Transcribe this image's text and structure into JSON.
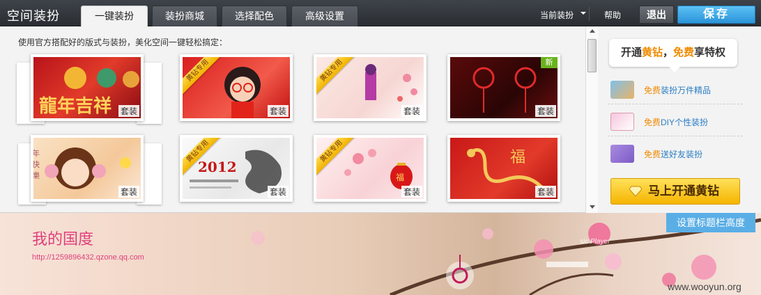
{
  "topbar": {
    "title": "空间装扮",
    "tabs": [
      {
        "label": "一键装扮",
        "active": true
      },
      {
        "label": "装扮商城",
        "active": false
      },
      {
        "label": "选择配色",
        "active": false
      },
      {
        "label": "高级设置",
        "active": false
      }
    ],
    "current_label": "当前装扮",
    "help_label": "帮助",
    "exit_label": "退出",
    "save_label": "保存"
  },
  "panel": {
    "description": "使用官方搭配好的版式与装扮，美化空间一键轻松搞定：",
    "suit_label": "套装",
    "ribbon_label": "黄钻专用",
    "new_label": "新",
    "thumbs": [
      {
        "name": "dragon-lucky",
        "text": "龍年吉祥"
      },
      {
        "name": "red-cartoon-girl",
        "text": ""
      },
      {
        "name": "plum-blossom-girl",
        "text": ""
      },
      {
        "name": "chinese-knot",
        "text": ""
      },
      {
        "name": "doll-new-year",
        "text": "年 快 樂"
      },
      {
        "name": "ink-dragon-2012",
        "text": "2012"
      },
      {
        "name": "red-lantern-blossom",
        "text": "福"
      },
      {
        "name": "golden-dragon",
        "text": "福"
      }
    ]
  },
  "sidebar": {
    "bubble_prefix": "开通",
    "bubble_highlight": "黄钻",
    "bubble_sep": "，",
    "bubble_free": "免费",
    "bubble_suffix": "享特权",
    "perks": [
      {
        "free": "免费",
        "text": "装扮万件精品",
        "icon": "gallery-icon"
      },
      {
        "free": "免费",
        "text": "DIY个性装扮",
        "icon": "monitor-icon"
      },
      {
        "free": "免费",
        "text": "送好友装扮",
        "icon": "gift-icon"
      }
    ],
    "open_button": "马上开通黄钻"
  },
  "banner": {
    "space_title": "我的国度",
    "space_url": "http://1259896432.qzone.qq.com",
    "height_button": "设置标题栏高度",
    "player_text": "sic Player",
    "watermark": "www.wooyun.org"
  },
  "colors": {
    "accent_blue": "#2a94d8",
    "gold": "#f5b400",
    "pink": "#e0407c"
  }
}
